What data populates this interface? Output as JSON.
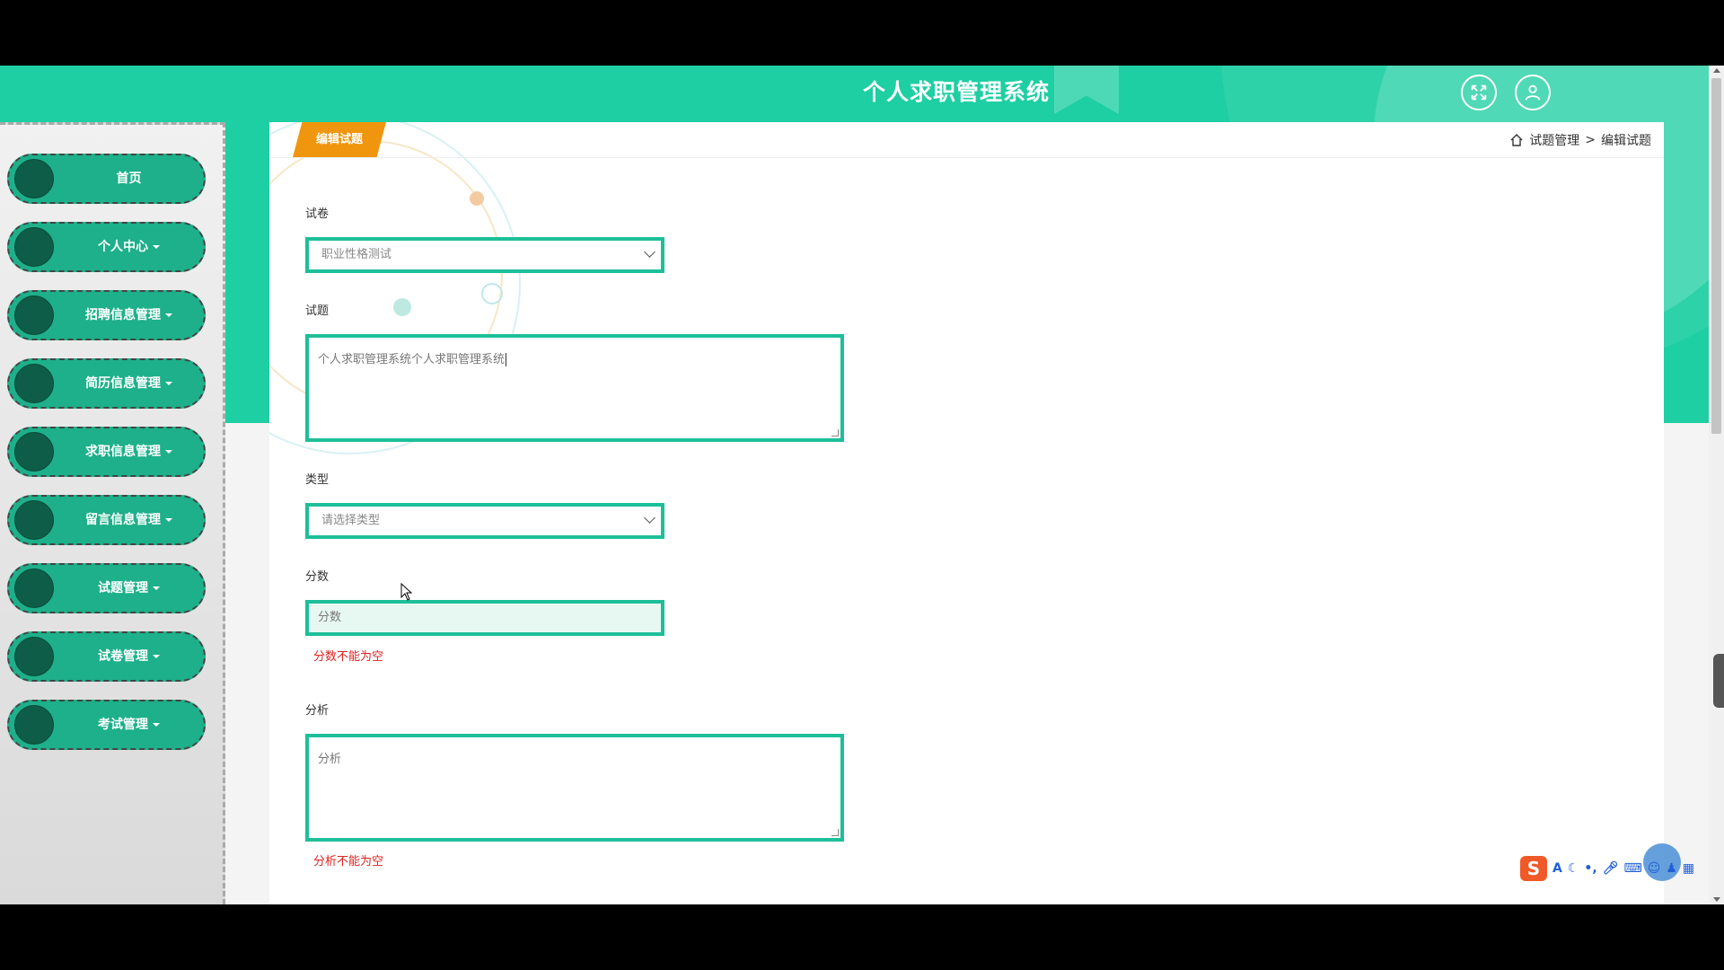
{
  "header": {
    "title": "个人求职管理系统"
  },
  "sidebar": {
    "items": [
      {
        "label": "首页",
        "has_caret": false
      },
      {
        "label": "个人中心",
        "has_caret": true
      },
      {
        "label": "招聘信息管理",
        "has_caret": true
      },
      {
        "label": "简历信息管理",
        "has_caret": true
      },
      {
        "label": "求职信息管理",
        "has_caret": true
      },
      {
        "label": "留言信息管理",
        "has_caret": true
      },
      {
        "label": "试题管理",
        "has_caret": true
      },
      {
        "label": "试卷管理",
        "has_caret": true
      },
      {
        "label": "考试管理",
        "has_caret": true
      }
    ]
  },
  "card": {
    "tab_label": "编辑试题",
    "breadcrumb": {
      "parent": "试题管理",
      "separator": ">",
      "current": "编辑试题"
    }
  },
  "form": {
    "paper": {
      "label": "试卷",
      "value": "职业性格测试"
    },
    "question": {
      "label": "试题",
      "value": "个人求职管理系统个人求职管理系统"
    },
    "type": {
      "label": "类型",
      "placeholder": "请选择类型"
    },
    "score": {
      "label": "分数",
      "placeholder": "分数",
      "error": "分数不能为空"
    },
    "analysis": {
      "label": "分析",
      "placeholder": "分析",
      "error": "分析不能为空"
    }
  },
  "ime": {
    "logo": "S",
    "mode": "A"
  },
  "colors": {
    "header_teal": "#1dcfa2",
    "nav_green": "#1db08a",
    "field_border": "#1dbf99",
    "tab_orange": "#f0960e",
    "error_red": "#dd2222"
  }
}
